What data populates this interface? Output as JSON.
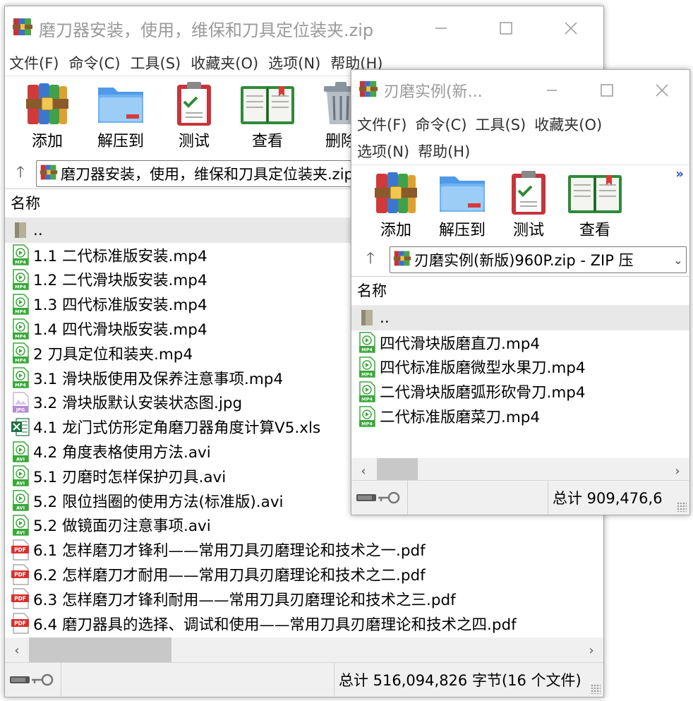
{
  "window1": {
    "title": "磨刀器安装，使用，维保和刀具定位装夹.zip",
    "menu": [
      "文件(F)",
      "命令(C)",
      "工具(S)",
      "收藏夹(O)",
      "选项(N)",
      "帮助(H)"
    ],
    "toolbar": [
      "添加",
      "解压到",
      "测试",
      "查看",
      "删除"
    ],
    "address": "磨刀器安装，使用，维保和刀具定位装夹.zip - ZIP 压缩文件",
    "column_header": "名称",
    "parent_row": "..",
    "files": [
      {
        "name": "1.1 二代标准版安装.mp4",
        "type": "mp4"
      },
      {
        "name": "1.2 二代滑块版安装.mp4",
        "type": "mp4"
      },
      {
        "name": "1.3 四代标准版安装.mp4",
        "type": "mp4"
      },
      {
        "name": "1.4 四代滑块版安装.mp4",
        "type": "mp4"
      },
      {
        "name": "2 刀具定位和装夹.mp4",
        "type": "mp4"
      },
      {
        "name": "3.1 滑块版使用及保养注意事项.mp4",
        "type": "mp4"
      },
      {
        "name": "3.2 滑块版默认安装状态图.jpg",
        "type": "jpg"
      },
      {
        "name": "4.1 龙门式仿形定角磨刀器角度计算V5.xls",
        "type": "xls"
      },
      {
        "name": "4.2 角度表格使用方法.avi",
        "type": "avi"
      },
      {
        "name": "5.1 刃磨时怎样保护刃具.avi",
        "type": "avi"
      },
      {
        "name": "5.2 限位挡圈的使用方法(标准版).avi",
        "type": "avi"
      },
      {
        "name": "5.2 做镜面刃注意事项.avi",
        "type": "avi"
      },
      {
        "name": "6.1 怎样磨刀才锋利——常用刀具刃磨理论和技术之一.pdf",
        "type": "pdf"
      },
      {
        "name": "6.2 怎样磨刀才耐用——常用刀具刃磨理论和技术之二.pdf",
        "type": "pdf"
      },
      {
        "name": "6.3 怎样磨刀才锋利耐用——常用刀具刃磨理论和技术之三.pdf",
        "type": "pdf"
      },
      {
        "name": "6.4 磨刀器具的选择、调试和使用——常用刀具刃磨理论和技术之四.pdf",
        "type": "pdf"
      }
    ],
    "status": "总计 516,094,826 字节(16 个文件)"
  },
  "window2": {
    "title": "刃磨实例(新...",
    "menu_row1": [
      "文件(F)",
      "命令(C)",
      "工具(S)",
      "收藏夹(O)"
    ],
    "menu_row2": [
      "选项(N)",
      "帮助(H)"
    ],
    "toolbar": [
      "添加",
      "解压到",
      "测试",
      "查看"
    ],
    "overflow": "»",
    "address": "刃磨实例(新版)960P.zip - ZIP 压",
    "column_header": "名称",
    "parent_row": "..",
    "files": [
      {
        "name": "四代滑块版磨直刀.mp4",
        "type": "mp4"
      },
      {
        "name": "四代标准版磨微型水果刀.mp4",
        "type": "mp4"
      },
      {
        "name": "二代滑块版磨弧形砍骨刀.mp4",
        "type": "mp4"
      },
      {
        "name": "二代标准版磨菜刀.mp4",
        "type": "mp4"
      }
    ],
    "status": "总计 909,476,6"
  },
  "icon_labels": {
    "mp4": "MP4",
    "avi": "AVI",
    "jpg": "JPG",
    "pdf": "PDF"
  },
  "colors": {
    "video_icon": "#3aa83a",
    "pdf_icon": "#d9302c",
    "xls_icon": "#1e7145",
    "jpg_icon": "#b48cd2",
    "title_inactive": "#9a9a9a"
  }
}
